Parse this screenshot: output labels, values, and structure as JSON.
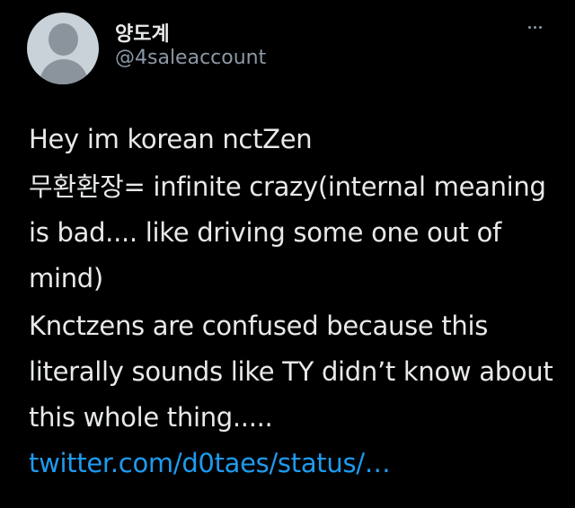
{
  "tweet": {
    "display_name": "양도계",
    "handle": "@4saleaccount",
    "paragraphs": [
      "Hey im korean nctZen",
      "무환환장= infinite crazy(internal meaning is bad.... like driving some one out of mind)",
      "Knctzens are confused because this literally sounds like TY didn’t know about this whole thing....."
    ],
    "link_text": "twitter.com/d0taes/status/…"
  },
  "icons": {
    "avatar": "default-profile-avatar",
    "more": "more-horizontal-icon"
  },
  "colors": {
    "background": "#000000",
    "text": "#e7e9ea",
    "secondary_text": "#8b98a5",
    "link": "#1d9bf0"
  }
}
